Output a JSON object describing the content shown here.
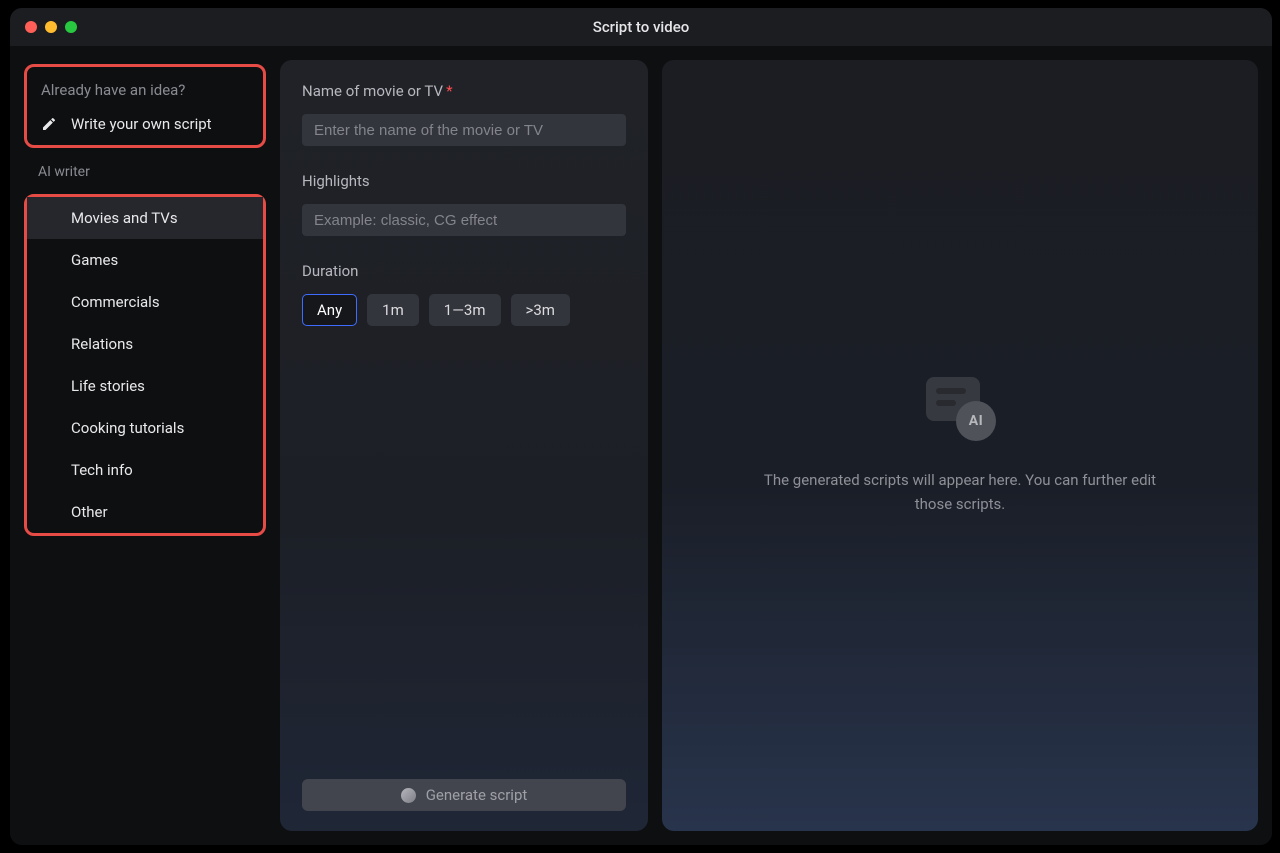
{
  "window": {
    "title": "Script to video"
  },
  "sidebar": {
    "idea_prompt": "Already have an idea?",
    "write_own": "Write your own script",
    "ai_writer_label": "AI writer",
    "categories": [
      {
        "label": "Movies and TVs",
        "active": true
      },
      {
        "label": "Games",
        "active": false
      },
      {
        "label": "Commercials",
        "active": false
      },
      {
        "label": "Relations",
        "active": false
      },
      {
        "label": "Life stories",
        "active": false
      },
      {
        "label": "Cooking tutorials",
        "active": false
      },
      {
        "label": "Tech info",
        "active": false
      },
      {
        "label": "Other",
        "active": false
      }
    ]
  },
  "form": {
    "name_label": "Name of movie or TV",
    "name_placeholder": "Enter the name of the movie or TV",
    "highlights_label": "Highlights",
    "highlights_placeholder": "Example: classic, CG effect",
    "duration_label": "Duration",
    "durations": [
      {
        "label": "Any",
        "active": true
      },
      {
        "label": "1m",
        "active": false
      },
      {
        "label": "1—3m",
        "active": false
      },
      {
        "label": ">3m",
        "active": false
      }
    ],
    "generate_label": "Generate script"
  },
  "preview": {
    "ai_badge": "AI",
    "empty_text": "The generated scripts will appear here. You can further edit those scripts."
  }
}
